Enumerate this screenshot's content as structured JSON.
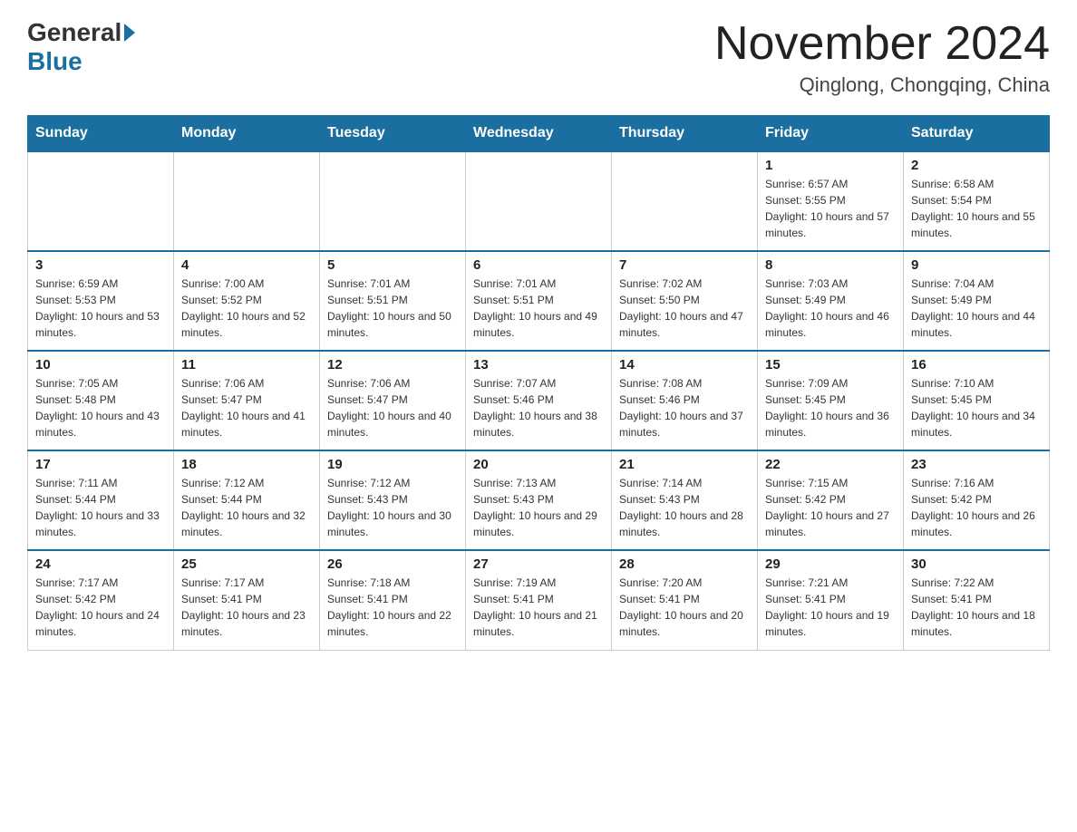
{
  "header": {
    "logo_general": "General",
    "logo_blue": "Blue",
    "month_title": "November 2024",
    "location": "Qinglong, Chongqing, China"
  },
  "weekdays": [
    "Sunday",
    "Monday",
    "Tuesday",
    "Wednesday",
    "Thursday",
    "Friday",
    "Saturday"
  ],
  "weeks": [
    [
      {
        "day": "",
        "info": ""
      },
      {
        "day": "",
        "info": ""
      },
      {
        "day": "",
        "info": ""
      },
      {
        "day": "",
        "info": ""
      },
      {
        "day": "",
        "info": ""
      },
      {
        "day": "1",
        "info": "Sunrise: 6:57 AM\nSunset: 5:55 PM\nDaylight: 10 hours and 57 minutes."
      },
      {
        "day": "2",
        "info": "Sunrise: 6:58 AM\nSunset: 5:54 PM\nDaylight: 10 hours and 55 minutes."
      }
    ],
    [
      {
        "day": "3",
        "info": "Sunrise: 6:59 AM\nSunset: 5:53 PM\nDaylight: 10 hours and 53 minutes."
      },
      {
        "day": "4",
        "info": "Sunrise: 7:00 AM\nSunset: 5:52 PM\nDaylight: 10 hours and 52 minutes."
      },
      {
        "day": "5",
        "info": "Sunrise: 7:01 AM\nSunset: 5:51 PM\nDaylight: 10 hours and 50 minutes."
      },
      {
        "day": "6",
        "info": "Sunrise: 7:01 AM\nSunset: 5:51 PM\nDaylight: 10 hours and 49 minutes."
      },
      {
        "day": "7",
        "info": "Sunrise: 7:02 AM\nSunset: 5:50 PM\nDaylight: 10 hours and 47 minutes."
      },
      {
        "day": "8",
        "info": "Sunrise: 7:03 AM\nSunset: 5:49 PM\nDaylight: 10 hours and 46 minutes."
      },
      {
        "day": "9",
        "info": "Sunrise: 7:04 AM\nSunset: 5:49 PM\nDaylight: 10 hours and 44 minutes."
      }
    ],
    [
      {
        "day": "10",
        "info": "Sunrise: 7:05 AM\nSunset: 5:48 PM\nDaylight: 10 hours and 43 minutes."
      },
      {
        "day": "11",
        "info": "Sunrise: 7:06 AM\nSunset: 5:47 PM\nDaylight: 10 hours and 41 minutes."
      },
      {
        "day": "12",
        "info": "Sunrise: 7:06 AM\nSunset: 5:47 PM\nDaylight: 10 hours and 40 minutes."
      },
      {
        "day": "13",
        "info": "Sunrise: 7:07 AM\nSunset: 5:46 PM\nDaylight: 10 hours and 38 minutes."
      },
      {
        "day": "14",
        "info": "Sunrise: 7:08 AM\nSunset: 5:46 PM\nDaylight: 10 hours and 37 minutes."
      },
      {
        "day": "15",
        "info": "Sunrise: 7:09 AM\nSunset: 5:45 PM\nDaylight: 10 hours and 36 minutes."
      },
      {
        "day": "16",
        "info": "Sunrise: 7:10 AM\nSunset: 5:45 PM\nDaylight: 10 hours and 34 minutes."
      }
    ],
    [
      {
        "day": "17",
        "info": "Sunrise: 7:11 AM\nSunset: 5:44 PM\nDaylight: 10 hours and 33 minutes."
      },
      {
        "day": "18",
        "info": "Sunrise: 7:12 AM\nSunset: 5:44 PM\nDaylight: 10 hours and 32 minutes."
      },
      {
        "day": "19",
        "info": "Sunrise: 7:12 AM\nSunset: 5:43 PM\nDaylight: 10 hours and 30 minutes."
      },
      {
        "day": "20",
        "info": "Sunrise: 7:13 AM\nSunset: 5:43 PM\nDaylight: 10 hours and 29 minutes."
      },
      {
        "day": "21",
        "info": "Sunrise: 7:14 AM\nSunset: 5:43 PM\nDaylight: 10 hours and 28 minutes."
      },
      {
        "day": "22",
        "info": "Sunrise: 7:15 AM\nSunset: 5:42 PM\nDaylight: 10 hours and 27 minutes."
      },
      {
        "day": "23",
        "info": "Sunrise: 7:16 AM\nSunset: 5:42 PM\nDaylight: 10 hours and 26 minutes."
      }
    ],
    [
      {
        "day": "24",
        "info": "Sunrise: 7:17 AM\nSunset: 5:42 PM\nDaylight: 10 hours and 24 minutes."
      },
      {
        "day": "25",
        "info": "Sunrise: 7:17 AM\nSunset: 5:41 PM\nDaylight: 10 hours and 23 minutes."
      },
      {
        "day": "26",
        "info": "Sunrise: 7:18 AM\nSunset: 5:41 PM\nDaylight: 10 hours and 22 minutes."
      },
      {
        "day": "27",
        "info": "Sunrise: 7:19 AM\nSunset: 5:41 PM\nDaylight: 10 hours and 21 minutes."
      },
      {
        "day": "28",
        "info": "Sunrise: 7:20 AM\nSunset: 5:41 PM\nDaylight: 10 hours and 20 minutes."
      },
      {
        "day": "29",
        "info": "Sunrise: 7:21 AM\nSunset: 5:41 PM\nDaylight: 10 hours and 19 minutes."
      },
      {
        "day": "30",
        "info": "Sunrise: 7:22 AM\nSunset: 5:41 PM\nDaylight: 10 hours and 18 minutes."
      }
    ]
  ]
}
